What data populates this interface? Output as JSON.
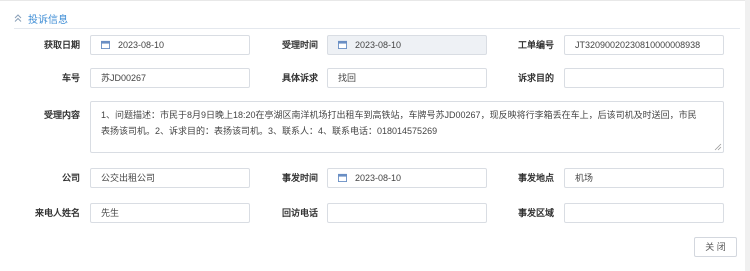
{
  "section": {
    "title": "投诉信息"
  },
  "form": {
    "acquire_date": {
      "label": "获取日期",
      "value": "2023-08-10"
    },
    "accept_time": {
      "label": "受理时间",
      "value": "2023-08-10"
    },
    "work_order_no": {
      "label": "工单编号",
      "value": "JT32090020230810000008938"
    },
    "plate_no": {
      "label": "车号",
      "value": "苏JD00267"
    },
    "specific_request": {
      "label": "具体诉求",
      "value": "找回"
    },
    "complaint_purpose": {
      "label": "诉求目的",
      "value": ""
    },
    "accept_content": {
      "label": "受理内容",
      "line1": "1、问题描述：市民于8月9日晚上18:20在亭湖区南洋机场打出租车到高铁站，车牌号苏JD00267，现反映将行李箱丢在车上，后该司机及时送回，市民",
      "line2": "表扬该司机。2、诉求目的：表扬该司机。3、联系人：4、联系电话：018014575269"
    },
    "company": {
      "label": "公司",
      "value": "公交出租公司"
    },
    "incident_time": {
      "label": "事发时间",
      "value": "2023-08-10"
    },
    "incident_place": {
      "label": "事发地点",
      "value": "机场"
    },
    "caller_name": {
      "label": "来电人姓名",
      "value": "先生"
    },
    "callback_phone": {
      "label": "回访电话",
      "value": ""
    },
    "incident_area": {
      "label": "事发区域",
      "value": ""
    }
  },
  "buttons": {
    "close": "关 闭"
  },
  "colors": {
    "accent": "#3f8ed6",
    "border": "#d9dde3",
    "disabled_bg": "#eef1f5"
  },
  "icons": {
    "collapse": "chevron-up-double-icon",
    "date": "calendar-icon"
  }
}
